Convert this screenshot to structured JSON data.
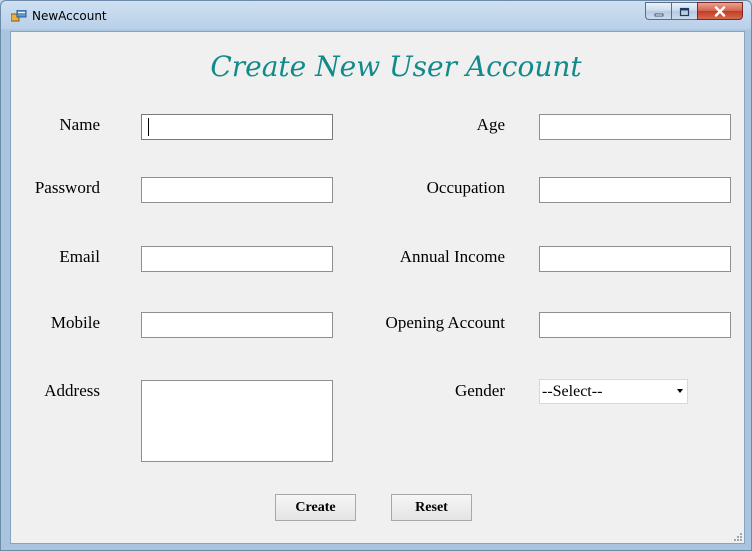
{
  "window": {
    "title": "NewAccount"
  },
  "form": {
    "heading": "Create New User Account",
    "left": [
      {
        "label": "Name",
        "value": ""
      },
      {
        "label": "Password",
        "value": ""
      },
      {
        "label": "Email",
        "value": ""
      },
      {
        "label": "Mobile",
        "value": ""
      },
      {
        "label": "Address",
        "value": ""
      }
    ],
    "right": [
      {
        "label": "Age",
        "value": ""
      },
      {
        "label": "Occupation",
        "value": ""
      },
      {
        "label": "Annual Income",
        "value": ""
      },
      {
        "label": "Opening Account",
        "value": ""
      }
    ],
    "gender": {
      "label": "Gender",
      "selected": "--Select--"
    },
    "buttons": {
      "create": "Create",
      "reset": "Reset"
    }
  },
  "icons": {
    "app": "app-window-icon",
    "minimize": "minimize-icon",
    "maximize": "maximize-icon",
    "close": "close-icon",
    "dropdown": "chevron-down-icon"
  },
  "colors": {
    "heading": "#138a8a",
    "close_button": "#c23d24",
    "client_background": "#f0f0f0"
  }
}
